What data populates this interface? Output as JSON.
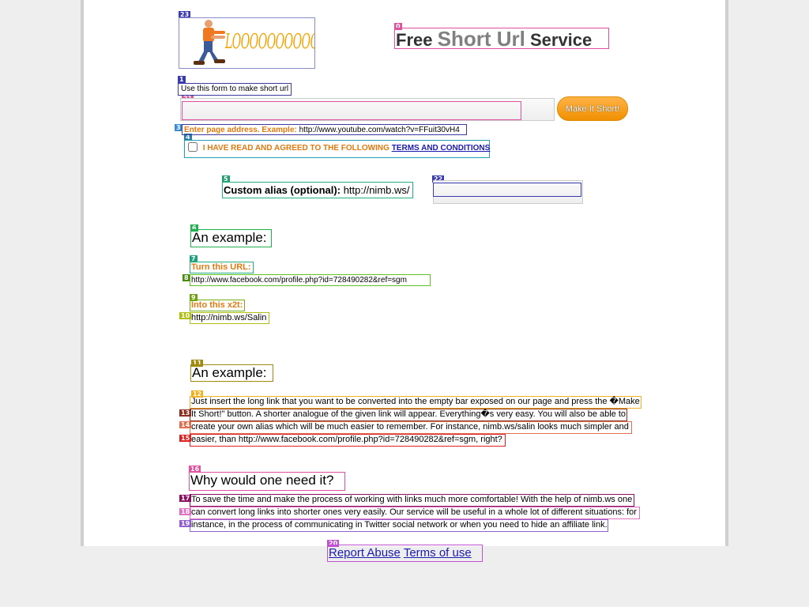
{
  "logo": {
    "text": "LOOOOOOOOOOONGURL.COM",
    "alt_name": "long-url-logo"
  },
  "header": {
    "title_part1": "Free",
    "title_part2": "Short Url",
    "title_part3": "Service"
  },
  "form": {
    "hint": "Use this form to make short url",
    "url_value": "",
    "make_short_label": "Make It Short!",
    "example_label": "Enter page address. Example:",
    "example_url": "http://www.youtube.com/watch?v=FFuit30vH4",
    "agree_text": "I HAVE READ AND AGREED TO THE FOLLOWING",
    "terms_link": "TERMS AND CONDITIONS",
    "alias_label": "Custom alias (optional):",
    "alias_prefix": "http://nimb.ws/",
    "alias_value": ""
  },
  "example1": {
    "heading": "An example:",
    "turn_label": "Turn this URL:",
    "long_url": "http://www.facebook.com/profile.php?id=728490282&ref=sgm",
    "into_label": "Into this x2t:",
    "short_url": "http://nimb.ws/Salin"
  },
  "example2": {
    "heading": "An example:",
    "lines": [
      "Just insert the long link that you want to be converted into the empty bar exposed on our page and press the \u0000Make",
      "It Short!\" button. A shorter analogue of the given link will appear. Everything\u0000s very easy. You will also be able to",
      "create your own alias which will be much easier to remember. For instance, nimb.ws/salin looks much simpler and",
      "easier, than http://www.facebook.com/profile.php?id=728490282&ref=sgm, right?"
    ]
  },
  "why": {
    "heading": "Why would one need it?",
    "lines": [
      "To save the time and make the process of working with links much more comfortable! With the help of nimb.ws one",
      "can convert long links into shorter ones very easily. Our service will be useful in a whole lot of different situations: for",
      "instance, in the process of communicating in Twitter social network or when you need to hide an affiliate link."
    ]
  },
  "footer": {
    "report_abuse": "Report Abuse",
    "terms_of_use": "Terms of use"
  },
  "labels": [
    "0",
    "1",
    "2",
    "3",
    "4",
    "5",
    "6",
    "7",
    "8",
    "9",
    "10",
    "11",
    "12",
    "13",
    "14",
    "15",
    "16",
    "17",
    "18",
    "19",
    "20",
    "21",
    "22",
    "23"
  ],
  "colors": {
    "accent_orange": "#e07a10",
    "link_blue": "#1a1ab0",
    "page_bg": "#eeeeee"
  }
}
